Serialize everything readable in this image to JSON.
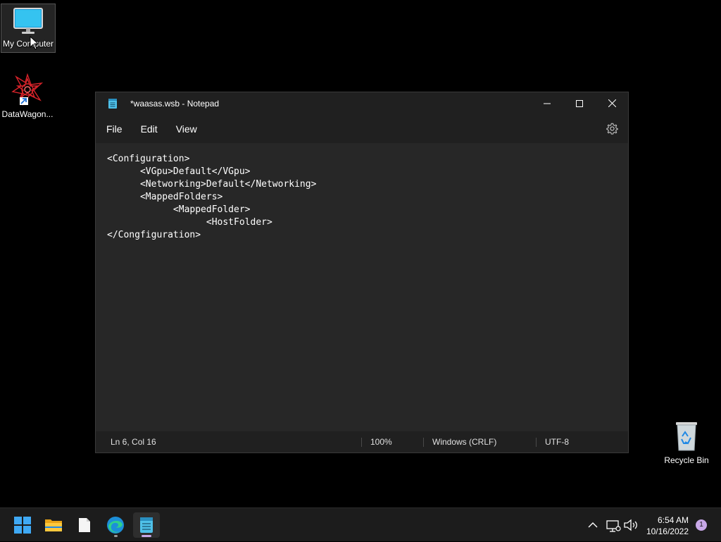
{
  "desktop": {
    "icons": [
      {
        "label": "My Computer"
      },
      {
        "label": "DataWagon..."
      },
      {
        "label": "Recycle Bin"
      }
    ]
  },
  "notepad": {
    "title": "*waasas.wsb - Notepad",
    "menu": [
      "File",
      "Edit",
      "View"
    ],
    "content": "<Configuration>\n      <VGpu>Default</VGpu>\n      <Networking>Default</Networking>\n      <MappedFolders>\n            <MappedFolder>\n                  <HostFolder>\n</Congfiguration>",
    "status": {
      "position": "Ln 6, Col 16",
      "zoom": "100%",
      "line_ending": "Windows (CRLF)",
      "encoding": "UTF-8"
    }
  },
  "taskbar": {
    "apps": [
      "start-icon",
      "file-explorer-icon",
      "file-icon",
      "edge-icon",
      "notepad-icon"
    ],
    "time": "6:54 AM",
    "date": "10/16/2022",
    "notification_count": "1"
  },
  "colors": {
    "accent": "#c8a8e8",
    "window_bg": "#272727",
    "titlebar_bg": "#202020"
  }
}
